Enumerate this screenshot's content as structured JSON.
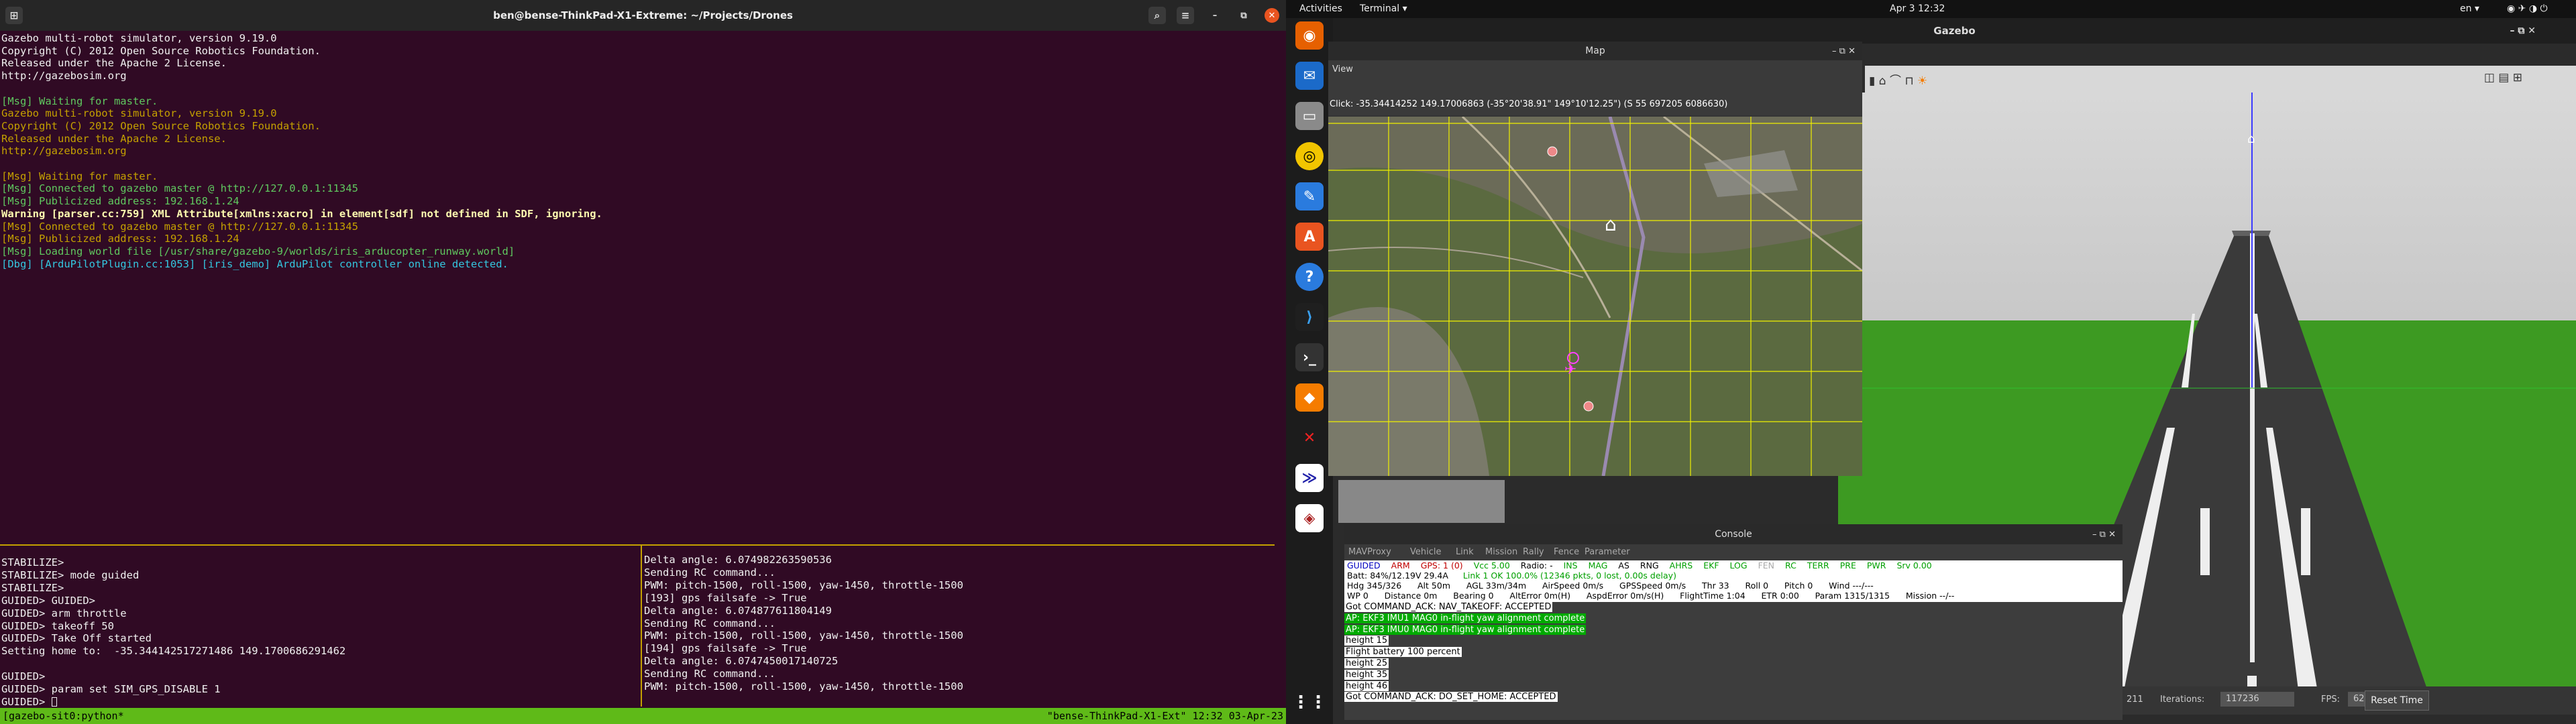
{
  "terminal": {
    "title": "ben@bense-ThinkPad-X1-Extreme: ~/Projects/Drones",
    "lines": [
      {
        "t": "Gazebo multi-robot simulator, version 9.19.0",
        "c": ""
      },
      {
        "t": "Copyright (C) 2012 Open Source Robotics Foundation.",
        "c": ""
      },
      {
        "t": "Released under the Apache 2 License.",
        "c": ""
      },
      {
        "t": "http://gazebosim.org",
        "c": ""
      },
      {
        "t": "",
        "c": ""
      },
      {
        "t": "[Msg] Waiting for master.",
        "c": "g"
      },
      {
        "t": "Gazebo multi-robot simulator, version 9.19.0",
        "c": "y"
      },
      {
        "t": "Copyright (C) 2012 Open Source Robotics Foundation.",
        "c": "y"
      },
      {
        "t": "Released under the Apache 2 License.",
        "c": "y"
      },
      {
        "t": "http://gazebosim.org",
        "c": "y"
      },
      {
        "t": "",
        "c": ""
      },
      {
        "t": "[Msg] Waiting for master.",
        "c": "y"
      },
      {
        "t": "[Msg] Connected to gazebo master @ http://127.0.0.1:11345",
        "c": "g"
      },
      {
        "t": "[Msg] Publicized address: 192.168.1.24",
        "c": "g"
      },
      {
        "t": "Warning [parser.cc:759] XML Attribute[xmlns:xacro] in element[sdf] not defined in SDF, ignoring.",
        "c": "w"
      },
      {
        "t": "[Msg] Connected to gazebo master @ http://127.0.0.1:11345",
        "c": "y"
      },
      {
        "t": "[Msg] Publicized address: 192.168.1.24",
        "c": "y"
      },
      {
        "t": "[Msg] Loading world file [/usr/share/gazebo-9/worlds/iris_arducopter_runway.world]",
        "c": "g"
      },
      {
        "t": "[Dbg] [ArduPilotPlugin.cc:1053] [iris_demo] ArduPilot controller online detected.",
        "c": "c"
      }
    ],
    "pane_left": [
      "STABILIZE>",
      "STABILIZE> mode guided",
      "STABILIZE>",
      "GUIDED> GUIDED>",
      "GUIDED> arm throttle",
      "GUIDED> takeoff 50",
      "GUIDED> Take Off started",
      "Setting home to:  -35.344142517271486 149.1700686291462",
      "",
      "GUIDED>",
      "GUIDED> param set SIM_GPS_DISABLE 1",
      "GUIDED> "
    ],
    "pane_right": [
      "Delta angle: 6.074982263590536",
      "Sending RC command...",
      "PWM: pitch-1500, roll-1500, yaw-1450, throttle-1500",
      "[193] gps failsafe -> True",
      "Delta angle: 6.074877611804149",
      "Sending RC command...",
      "PWM: pitch-1500, roll-1500, yaw-1450, throttle-1500",
      "[194] gps failsafe -> True",
      "Delta angle: 6.0747450017140725",
      "Sending RC command...",
      "PWM: pitch-1500, roll-1500, yaw-1450, throttle-1500"
    ],
    "tmux_left": "[gazebo-sit0:python*",
    "tmux_right": "\"bense-ThinkPad-X1-Ext\" 12:32 03-Apr-23"
  },
  "topbar": {
    "activities": "Activities",
    "app": "Terminal ▾",
    "clock": "Apr 3  12:32",
    "lang": "en ▾"
  },
  "gazebo": {
    "title": "Gazebo",
    "real_time": "211",
    "iterations_label": "Iterations:",
    "iterations": "117236",
    "fps_label": "FPS:",
    "fps": "62.52",
    "reset": "Reset Time"
  },
  "map": {
    "title": "Map",
    "menu": "View",
    "click": "Click: -35.34414252 149.17006863 (-35°20'38.91\" 149°10'12.25\") (S 55 697205 6086630)"
  },
  "console": {
    "title": "Console",
    "menu": [
      "MAVProxy",
      "Vehicle",
      "Link",
      "Mission",
      "Rally",
      "Fence",
      "Parameter"
    ],
    "status1": [
      {
        "t": "GUIDED",
        "c": "#0000c0"
      },
      {
        "t": "ARM",
        "c": "#c00000"
      },
      {
        "t": "GPS: 1 (0)",
        "c": "#c00000"
      },
      {
        "t": "Vcc 5.00",
        "c": "#00a000"
      },
      {
        "t": "Radio: -",
        "c": "#000"
      },
      {
        "t": "INS",
        "c": "#00a000"
      },
      {
        "t": "MAG",
        "c": "#00a000"
      },
      {
        "t": "AS",
        "c": "#000"
      },
      {
        "t": "RNG",
        "c": "#000"
      },
      {
        "t": "AHRS",
        "c": "#00a000"
      },
      {
        "t": "EKF",
        "c": "#00a000"
      },
      {
        "t": "LOG",
        "c": "#00a000"
      },
      {
        "t": "FEN",
        "c": "#aaa"
      },
      {
        "t": "RC",
        "c": "#00a000"
      },
      {
        "t": "TERR",
        "c": "#00a000"
      },
      {
        "t": "PRE",
        "c": "#00a000"
      },
      {
        "t": "PWR",
        "c": "#00a000"
      },
      {
        "t": "Srv 0.00",
        "c": "#00a000"
      }
    ],
    "status2": "Batt: 84%/12.19V 29.4A",
    "status2b": "Link 1 OK 100.0% (12346 pkts, 0 lost, 0.00s delay)",
    "status3": "Hdg 345/326      Alt 50m      AGL 33m/34m      AirSpeed 0m/s      GPSSpeed 0m/s      Thr 33      Roll 0      Pitch 0      Wind ---/---",
    "status4": "WP 0      Distance 0m      Bearing 0      AltError 0m(H)      AspdError 0m/s(H)      FlightTime 1:04      ETR 0:00      Param 1315/1315      Mission --/--",
    "log": [
      {
        "t": "Got COMMAND_ACK: NAV_TAKEOFF: ACCEPTED",
        "k": "wb"
      },
      {
        "t": "AP: EKF3 IMU1 MAG0 in-flight yaw alignment complete",
        "k": "gb"
      },
      {
        "t": "AP: EKF3 IMU0 MAG0 in-flight yaw alignment complete",
        "k": "gb"
      },
      {
        "t": "height 15",
        "k": "wb"
      },
      {
        "t": "Flight battery 100 percent",
        "k": "wb"
      },
      {
        "t": "height 25",
        "k": "wb"
      },
      {
        "t": "height 35",
        "k": "wb"
      },
      {
        "t": "height 46",
        "k": "wb"
      },
      {
        "t": "Got COMMAND_ACK: DO_SET_HOME: ACCEPTED",
        "k": "wb"
      }
    ]
  },
  "colors": {
    "term_bg": "#300a24",
    "tmux": "#5fba18",
    "grass": "#3a9a1e"
  }
}
